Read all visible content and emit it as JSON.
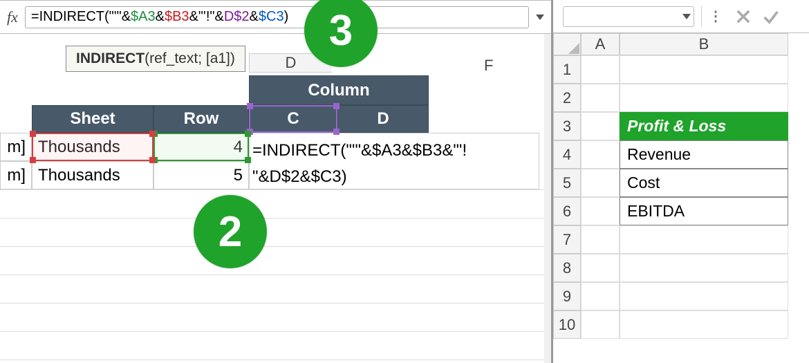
{
  "formula_bar": {
    "fx_label": "fx",
    "tokens": {
      "t0": "=INDIRECT(\"'\"&",
      "a3": "$A3",
      "amp1": "&",
      "b3": "$B3",
      "mid": "&\"'!\"&",
      "d2": "D$2",
      "amp2": "&",
      "c3": "$C3",
      "close": ")"
    }
  },
  "fn_tooltip": {
    "name": "INDIRECT",
    "args": "(ref_text; [a1])"
  },
  "left_headers": {
    "col_D": "D",
    "col_F": "F",
    "column_label": "Column",
    "sheet_label": "Sheet",
    "row_label": "Row",
    "sub_C": "C",
    "sub_D": "D"
  },
  "left_data": {
    "m1": "m]",
    "m2": "m]",
    "th1": "Thousands",
    "th2": "Thousands",
    "row1": "4",
    "row2": "5",
    "formula_line1": "=INDIRECT(\"'\"&$A3&$B3&\"'!",
    "formula_line2": "\"&D$2&$C3)"
  },
  "annotations": {
    "badge2": "2",
    "badge3": "3"
  },
  "right": {
    "col_A": "A",
    "col_B": "B",
    "rows": [
      "1",
      "2",
      "3",
      "4",
      "5",
      "6",
      "7",
      "8",
      "9",
      "10"
    ],
    "b3": "Profit & Loss",
    "b4": "Revenue",
    "b5": "Cost",
    "b6": "EBITDA"
  }
}
